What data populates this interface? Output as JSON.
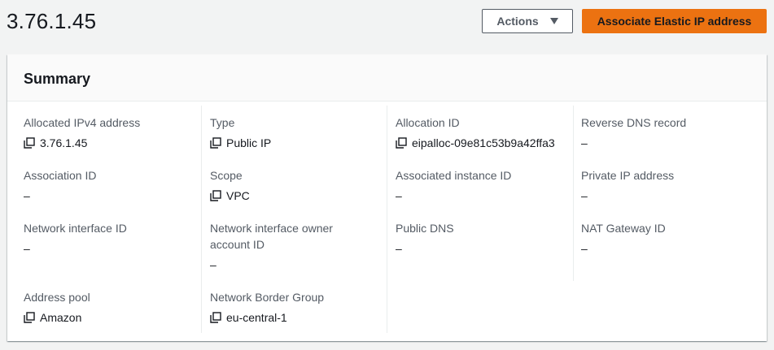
{
  "header": {
    "title": "3.76.1.45",
    "actions_label": "Actions",
    "primary_label": "Associate Elastic IP address"
  },
  "summary": {
    "title": "Summary",
    "fields": {
      "allocated_ipv4": {
        "label": "Allocated IPv4 address",
        "value": "3.76.1.45"
      },
      "type": {
        "label": "Type",
        "value": "Public IP"
      },
      "allocation_id": {
        "label": "Allocation ID",
        "value": "eipalloc-09e81c53b9a42ffa3"
      },
      "reverse_dns": {
        "label": "Reverse DNS record",
        "value": "–"
      },
      "association_id": {
        "label": "Association ID",
        "value": "–"
      },
      "scope": {
        "label": "Scope",
        "value": "VPC"
      },
      "associated_instance_id": {
        "label": "Associated instance ID",
        "value": "–"
      },
      "private_ip": {
        "label": "Private IP address",
        "value": "–"
      },
      "network_interface_id": {
        "label": "Network interface ID",
        "value": "–"
      },
      "network_interface_owner": {
        "label": "Network interface owner account ID",
        "value": "–"
      },
      "public_dns": {
        "label": "Public DNS",
        "value": "–"
      },
      "nat_gateway_id": {
        "label": "NAT Gateway ID",
        "value": "–"
      },
      "address_pool": {
        "label": "Address pool",
        "value": "Amazon"
      },
      "network_border_group": {
        "label": "Network Border Group",
        "value": "eu-central-1"
      }
    }
  },
  "icons": {
    "copy": "copy-icon",
    "actions_caret": "caret-down-icon"
  },
  "colors": {
    "primary": "#ec7211",
    "background": "#f2f3f3",
    "label": "#545b64",
    "text": "#16191f"
  }
}
